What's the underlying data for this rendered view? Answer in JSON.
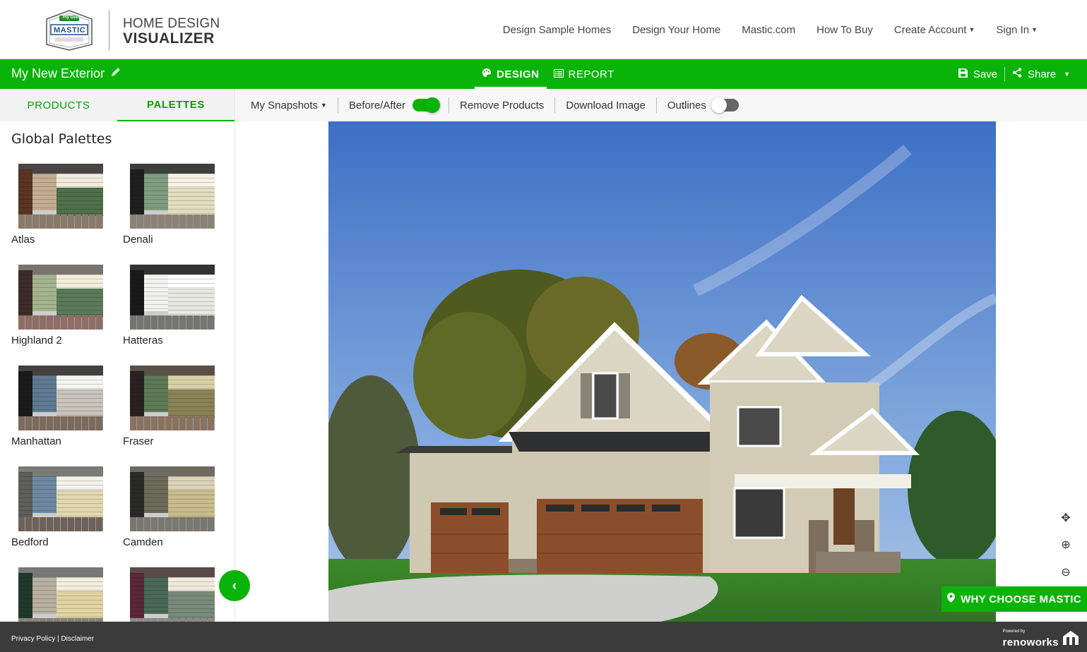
{
  "header": {
    "logo_brand_small": "Ply Gem",
    "logo_brand": "MASTIC",
    "logo_line1": "HOME DESIGN",
    "logo_line2": "VISUALIZER",
    "nav": {
      "design_sample": "Design Sample Homes",
      "design_your": "Design Your Home",
      "mastic_com": "Mastic.com",
      "how_to_buy": "How To Buy",
      "create_account": "Create Account",
      "sign_in": "Sign In"
    }
  },
  "greenbar": {
    "project_name": "My New Exterior",
    "tab_design": "DESIGN",
    "tab_report": "REPORT",
    "save": "Save",
    "share": "Share"
  },
  "panel": {
    "tab_products": "PRODUCTS",
    "tab_palettes": "PALETTES",
    "heading": "Global Palettes",
    "palettes": [
      {
        "name": "Atlas",
        "roof": "#4a4444",
        "shutter": "#5a3525",
        "a": "#c4ac90",
        "b": "#f0ebdc",
        "c": "#4e7048",
        "stone": "#8a7a6a"
      },
      {
        "name": "Denali",
        "roof": "#3e3e3e",
        "shutter": "#1f1f1f",
        "a": "#7f9c80",
        "b": "#f6f2e6",
        "c": "#e4dcbf",
        "stone": "#8c8276"
      },
      {
        "name": "Highland 2",
        "roof": "#7a7470",
        "shutter": "#3e2c28",
        "a": "#a3b48e",
        "b": "#f3efdd",
        "c": "#5a7a5a",
        "stone": "#8e6e66"
      },
      {
        "name": "Hatteras",
        "roof": "#333333",
        "shutter": "#1a1a1a",
        "a": "#f2f2ee",
        "b": "#ffffff",
        "c": "#e8e8e2",
        "stone": "#777570"
      },
      {
        "name": "Manhattan",
        "roof": "#444040",
        "shutter": "#1a1a1a",
        "a": "#5e7a92",
        "b": "#f5f5f2",
        "c": "#c8c4bc",
        "stone": "#7c6a5c"
      },
      {
        "name": "Fraser",
        "roof": "#5a5048",
        "shutter": "#2a2222",
        "a": "#5d7a56",
        "b": "#d8d0a8",
        "c": "#8a8258",
        "stone": "#8a7260"
      },
      {
        "name": "Bedford",
        "roof": "#7a7a76",
        "shutter": "#5e5e5a",
        "a": "#6e8aa2",
        "b": "#f4f2ea",
        "c": "#e2d8b0",
        "stone": "#6e6258"
      },
      {
        "name": "Camden",
        "roof": "#6e6a64",
        "shutter": "#2a2a28",
        "a": "#6c6a58",
        "b": "#d9d4b8",
        "c": "#c8bc8e",
        "stone": "#7a7670"
      },
      {
        "name": "",
        "roof": "#777",
        "shutter": "#1e3a2c",
        "a": "#b8b0a0",
        "b": "#f2eedc",
        "c": "#e0d4a2",
        "stone": "#8a8074"
      },
      {
        "name": "",
        "roof": "#5a4a48",
        "shutter": "#5a2838",
        "a": "#4a6858",
        "b": "#f0eadc",
        "c": "#7a8a78",
        "stone": "#8a8a86"
      }
    ]
  },
  "toolbar": {
    "snapshots": "My Snapshots",
    "before_after": "Before/After",
    "remove_products": "Remove Products",
    "download_image": "Download Image",
    "outlines": "Outlines",
    "before_after_on": true,
    "outlines_on": false
  },
  "viewer": {
    "why_choose": "WHY CHOOSE MASTIC"
  },
  "footer": {
    "privacy": "Privacy Policy",
    "separator": " | ",
    "disclaimer": "Disclaimer",
    "powered_by": "Powered by",
    "brand": "renoworks"
  },
  "colors": {
    "accent_green": "#0ab30a",
    "footer_bg": "#3b3b3b"
  }
}
